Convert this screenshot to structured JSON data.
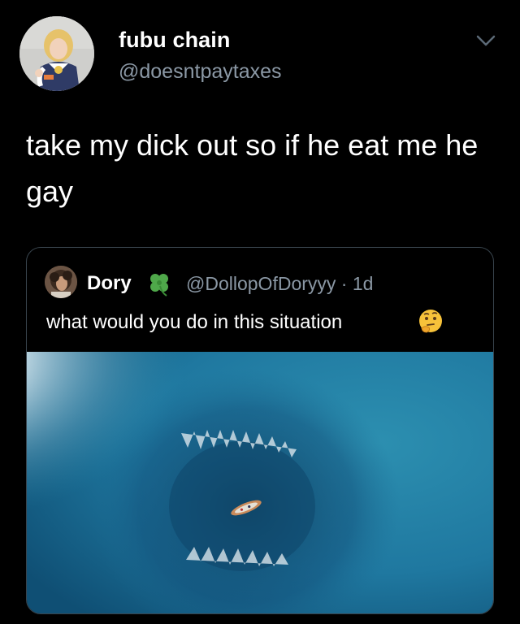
{
  "author": {
    "display_name": "fubu chain",
    "handle": "@doesntpaytaxes",
    "avatar_icon": "cosplay-avatar"
  },
  "tweet": {
    "text": "take my dick out so if he eat me he gay"
  },
  "quoted_tweet": {
    "display_name": "Dory",
    "badge_icon": "four-leaf-clover",
    "handle_time": "@DollopOfDoryyy · 1d",
    "text": "what would you do in this situation",
    "emoji": "thinking-face",
    "image_description_icon": "shark-below-boat-photo"
  },
  "colors": {
    "background": "#000000",
    "text_primary": "#ffffff",
    "text_secondary": "#8b98a5",
    "border": "#38444d"
  }
}
